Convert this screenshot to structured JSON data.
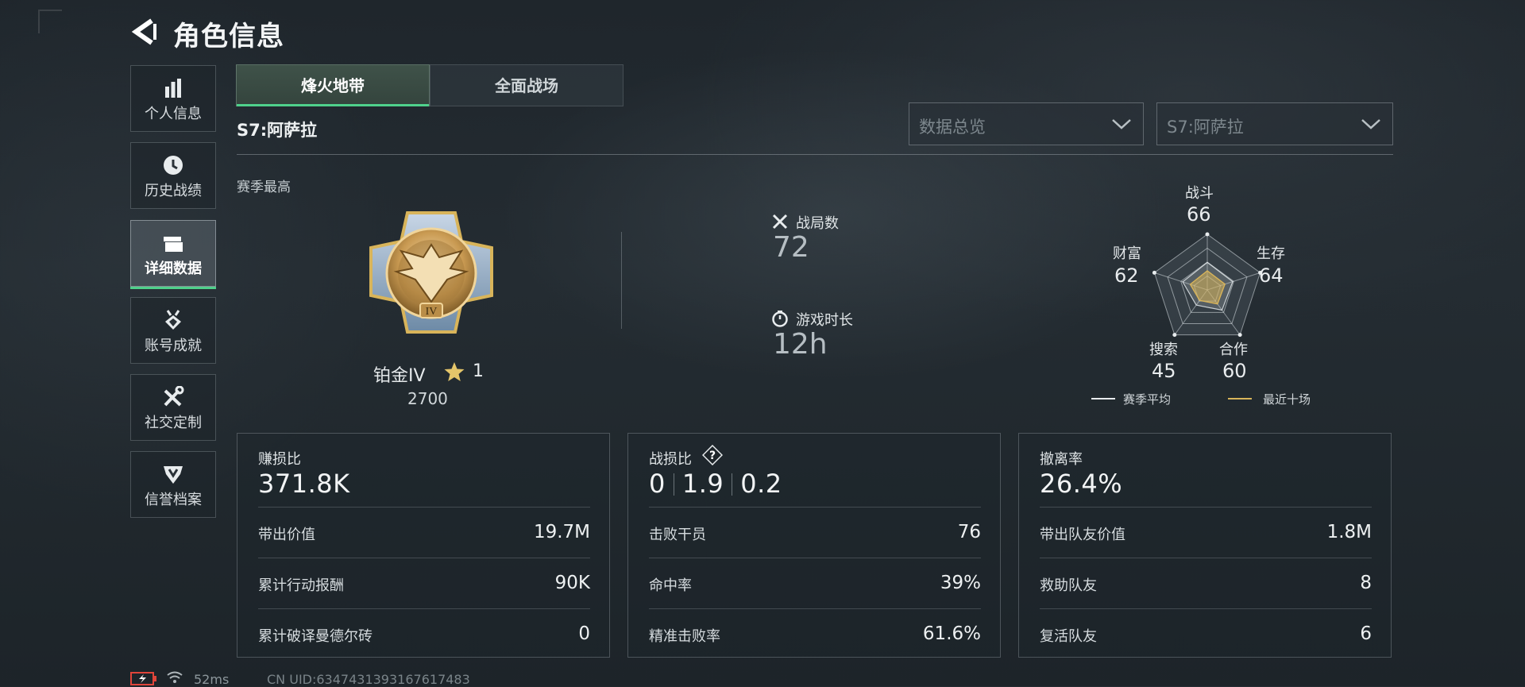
{
  "header": {
    "title": "角色信息"
  },
  "sidebar": {
    "items": [
      {
        "label": "个人信息",
        "icon": "bar-chart-icon"
      },
      {
        "label": "历史战绩",
        "icon": "clock-icon"
      },
      {
        "label": "详细数据",
        "icon": "folder-icon",
        "active": true
      },
      {
        "label": "账号成就",
        "icon": "medal-icon"
      },
      {
        "label": "社交定制",
        "icon": "tools-icon"
      },
      {
        "label": "信誉档案",
        "icon": "shield-icon"
      }
    ]
  },
  "tabs": [
    {
      "label": "烽火地带",
      "active": true
    },
    {
      "label": "全面战场",
      "active": false
    }
  ],
  "season": {
    "title": "S7:阿萨拉",
    "best_label": "赛季最高"
  },
  "dropdowns": {
    "view": {
      "value": "数据总览"
    },
    "season": {
      "value": "S7:阿萨拉"
    }
  },
  "rank": {
    "name": "铂金IV",
    "stars": "1",
    "score": "2700"
  },
  "match": {
    "games_label": "战局数",
    "games_value": "72",
    "time_label": "游戏时长",
    "time_value": "12h"
  },
  "radar": {
    "combat_label": "战斗",
    "combat": "66",
    "survival_label": "生存",
    "survival": "64",
    "teamwork_label": "合作",
    "teamwork": "60",
    "search_label": "搜索",
    "search": "45",
    "wealth_label": "财富",
    "wealth": "62",
    "legend_season": "赛季平均",
    "legend_recent": "最近十场",
    "values": {
      "combat": 66,
      "survival": 64,
      "teamwork": 60,
      "search": 45,
      "wealth": 62
    }
  },
  "panels": {
    "profit": {
      "title": "赚损比",
      "big": "371.8K",
      "rows": [
        {
          "k": "带出价值",
          "v": "19.7M"
        },
        {
          "k": "累计行动报酬",
          "v": "90K"
        },
        {
          "k": "累计破译曼德尔砖",
          "v": "0"
        }
      ]
    },
    "kd": {
      "title": "战损比",
      "v1": "0",
      "v2": "1.9",
      "v3": "0.2",
      "rows": [
        {
          "k": "击败干员",
          "v": "76"
        },
        {
          "k": "命中率",
          "v": "39%"
        },
        {
          "k": "精准击败率",
          "v": "61.6%"
        }
      ]
    },
    "extract": {
      "title": "撤离率",
      "big": "26.4%",
      "rows": [
        {
          "k": "带出队友价值",
          "v": "1.8M"
        },
        {
          "k": "救助队友",
          "v": "8"
        },
        {
          "k": "复活队友",
          "v": "6"
        }
      ]
    }
  },
  "status": {
    "ping": "52ms",
    "uid": "CN UID:6347431393167617483"
  },
  "colors": {
    "accent": "#4fd18b",
    "gold": "#d8b45a",
    "star": "#e4c56a"
  }
}
